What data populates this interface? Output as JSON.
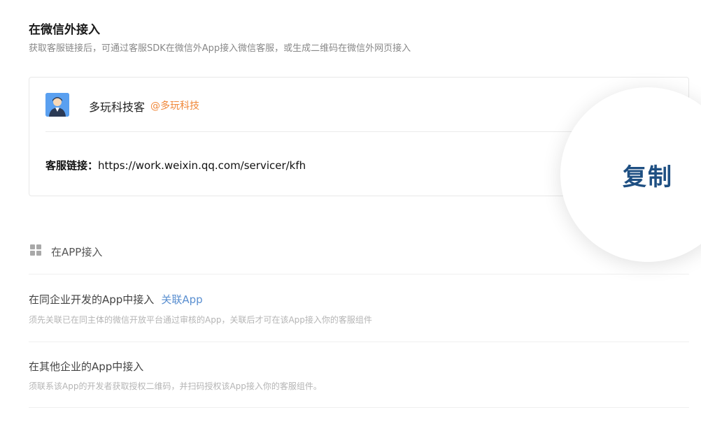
{
  "outside": {
    "title": "在微信外接入",
    "desc": "获取客服链接后，可通过客服SDK在微信外App接入微信客服，或生成二维码在微信外网页接入"
  },
  "card": {
    "avatar_icon": "customer-service-avatar",
    "name": "多玩科技客",
    "corp": "@多玩科技",
    "link_label": "客服链接：",
    "link_url": "https://work.weixin.qq.com/servicer/kfh",
    "copy_label": "复制"
  },
  "app": {
    "icon": "grid-icon",
    "title": "在APP接入",
    "options": [
      {
        "title": "在同企业开发的App中接入",
        "link": "关联App",
        "desc": "须先关联已在同主体的微信开放平台通过审核的App，关联后才可在该App接入你的客服组件"
      },
      {
        "title": "在其他企业的App中接入",
        "desc": "须联系该App的开发者获取授权二维码，并扫码授权该App接入你的客服组件。"
      }
    ]
  },
  "colors": {
    "accent_orange": "#f0883a",
    "link_blue": "#5a8fd0",
    "copy_blue": "#1e4f82"
  }
}
